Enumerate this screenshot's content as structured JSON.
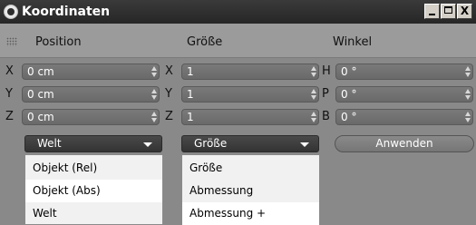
{
  "window": {
    "title": "Koordinaten",
    "buttons": [
      "_",
      "□",
      "X"
    ]
  },
  "header": {
    "position": "Position",
    "size": "Größe",
    "angle": "Winkel"
  },
  "position_fields": [
    {
      "axis": "X",
      "value": "0 cm"
    },
    {
      "axis": "Y",
      "value": "0 cm"
    },
    {
      "axis": "Z",
      "value": "0 cm"
    }
  ],
  "size_fields": [
    {
      "axis": "X",
      "value": "1"
    },
    {
      "axis": "Y",
      "value": "1"
    },
    {
      "axis": "Z",
      "value": "1"
    }
  ],
  "angle_fields": [
    {
      "axis": "H",
      "value": "0 °"
    },
    {
      "axis": "P",
      "value": "0 °"
    },
    {
      "axis": "B",
      "value": "0 °"
    }
  ],
  "dropdowns": {
    "coordinate_system": {
      "selected": "Welt",
      "options": [
        "Objekt (Rel)",
        "Objekt (Abs)",
        "Welt"
      ]
    },
    "size_mode": {
      "selected": "Größe",
      "options": [
        "Größe",
        "Abmessung",
        "Abmessung +"
      ]
    }
  },
  "apply_label": "Anwenden",
  "colors": {
    "field_bg": "#707070",
    "window_bg": "#898989",
    "title_bg": "#2b2b2b",
    "menu_bg": "#f1f1f1"
  }
}
